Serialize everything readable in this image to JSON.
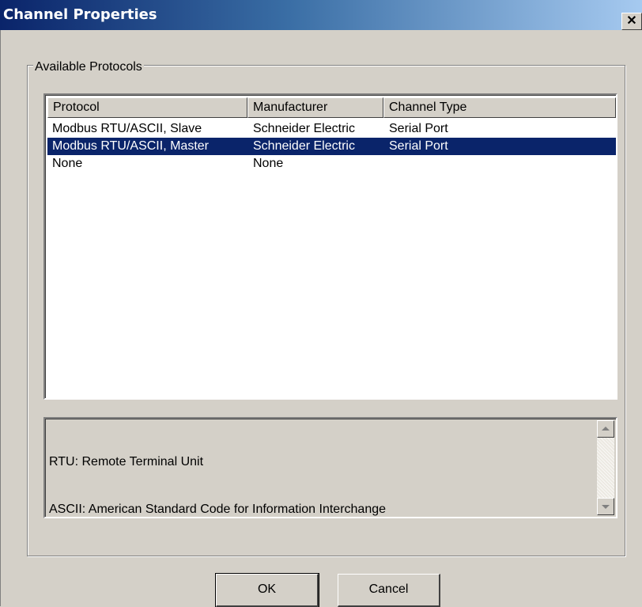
{
  "window": {
    "title": "Channel Properties",
    "close_glyph": "✕"
  },
  "group": {
    "label": "Available Protocols"
  },
  "table": {
    "columns": [
      "Protocol",
      "Manufacturer",
      "Channel Type"
    ],
    "rows": [
      {
        "protocol": "Modbus RTU/ASCII, Slave",
        "manufacturer": "Schneider Electric",
        "channel_type": "Serial Port",
        "selected": false
      },
      {
        "protocol": "Modbus RTU/ASCII, Master",
        "manufacturer": "Schneider Electric",
        "channel_type": "Serial Port",
        "selected": true
      },
      {
        "protocol": "None",
        "manufacturer": "None",
        "channel_type": "",
        "selected": false
      }
    ]
  },
  "description": {
    "lines": [
      "RTU: Remote Terminal Unit",
      "ASCII: American Standard Code for Information Interchange"
    ]
  },
  "buttons": {
    "ok": "OK",
    "cancel": "Cancel"
  },
  "colors": {
    "title_bar_start": "#0a246a",
    "title_bar_end": "#a6caf0",
    "selection": "#0a246a",
    "dialog_face": "#d4d0c8"
  },
  "icons": {
    "close": "close-icon",
    "scroll_up": "scroll-up-arrow-icon",
    "scroll_down": "scroll-down-arrow-icon"
  }
}
